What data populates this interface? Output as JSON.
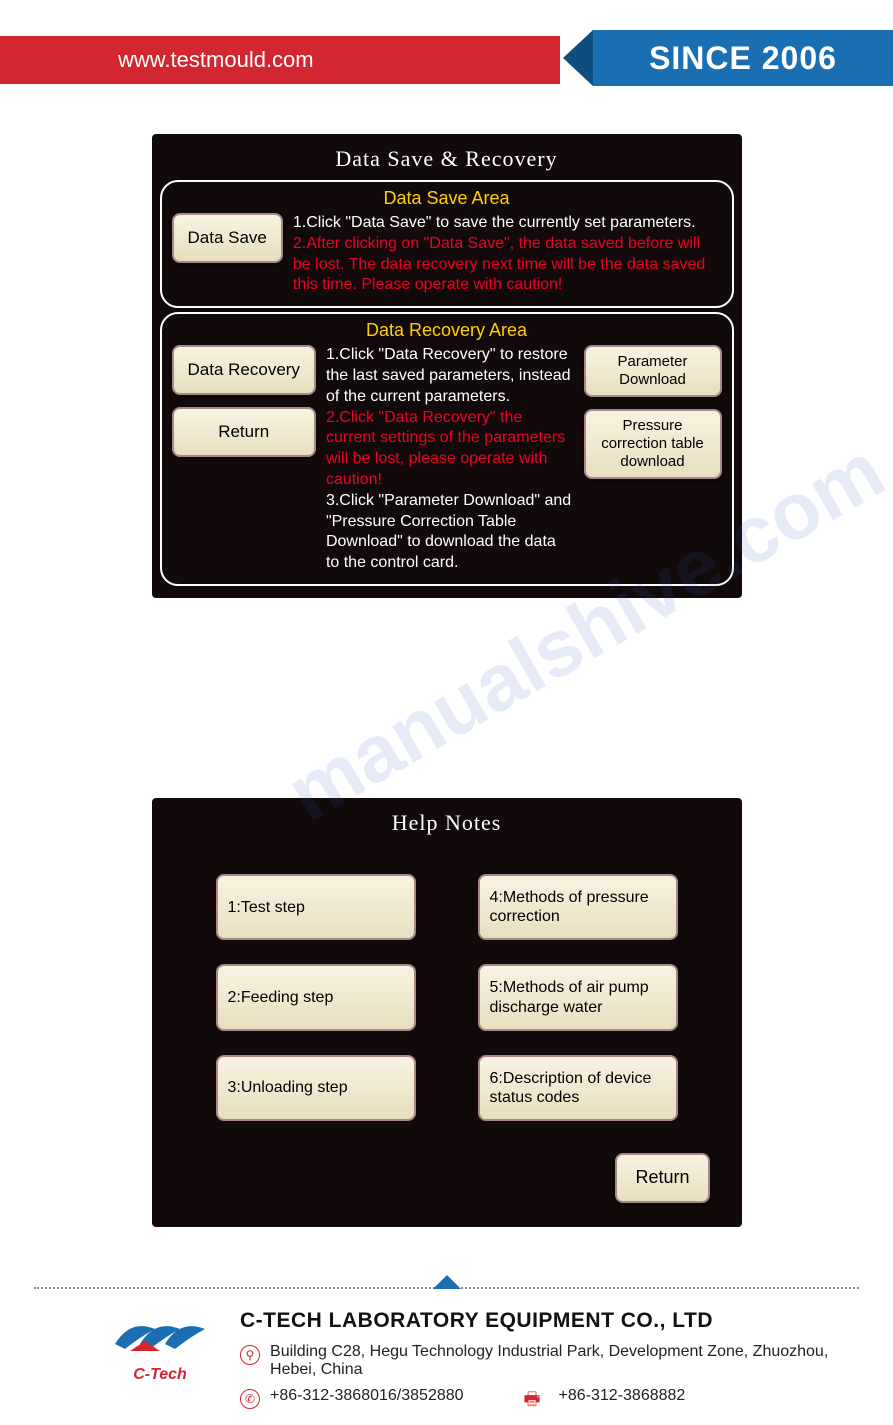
{
  "header": {
    "url": "www.testmould.com",
    "since": "SINCE 2006"
  },
  "screen1": {
    "title": "Data Save & Recovery",
    "save": {
      "title": "Data Save Area",
      "btn": "Data Save",
      "line1": "1.Click \"Data Save\" to save the currently set parameters.",
      "line2": "2.After clicking on \"Data Save\", the data saved before will be lost. The data recovery next time will be the data saved this time. Please operate with caution!"
    },
    "recovery": {
      "title": "Data Recovery Area",
      "btn1": "Data Recovery",
      "btn2": "Return",
      "btn3": "Parameter Download",
      "btn4": "Pressure correction table download",
      "line1": "1.Click \"Data Recovery\" to restore the last saved parameters, instead of the current parameters.",
      "line2": "2.Click \"Data Recovery\" the current settings of the parameters will be lost, please operate with caution!",
      "line3": "3.Click \"Parameter Download\" and \"Pressure Correction Table Download\" to download the data to the control card."
    }
  },
  "screen2": {
    "title": "Help Notes",
    "items": [
      "1:Test step",
      "4:Methods of pressure correction",
      "2:Feeding step",
      "5:Methods of air pump discharge water",
      "3:Unloading step",
      "6:Description of device status codes"
    ],
    "return": "Return"
  },
  "footer": {
    "company": "C-TECH LABORATORY EQUIPMENT CO., LTD",
    "logo": "C-Tech",
    "address": "Building C28, Hegu Technology Industrial Park, Development Zone, Zhuozhou, Hebei, China",
    "phone": "+86-312-3868016/3852880",
    "fax": "+86-312-3868882"
  },
  "watermark": "manualshive.com"
}
